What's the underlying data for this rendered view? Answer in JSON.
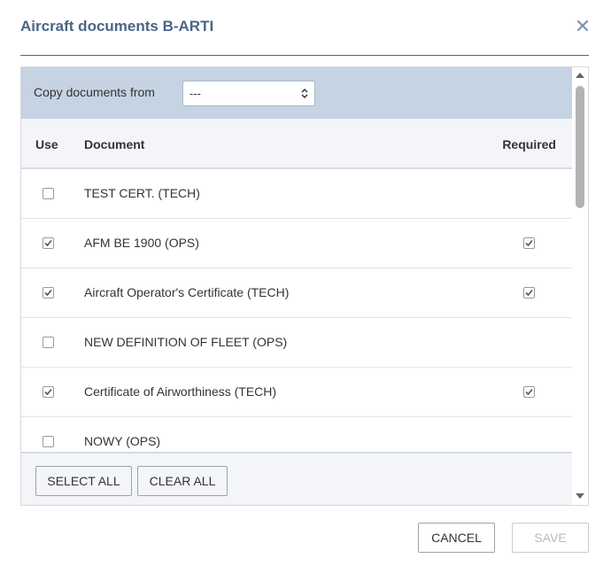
{
  "dialog": {
    "title": "Aircraft documents B-ARTI",
    "close_icon": "close-icon"
  },
  "copy_from": {
    "label": "Copy documents from",
    "selected": "---"
  },
  "table": {
    "headers": {
      "use": "Use",
      "document": "Document",
      "required": "Required"
    },
    "rows": [
      {
        "name": "TEST CERT. (TECH)",
        "use": false,
        "required": false
      },
      {
        "name": "AFM BE 1900 (OPS)",
        "use": true,
        "required": true
      },
      {
        "name": "Aircraft Operator's Certificate (TECH)",
        "use": true,
        "required": true
      },
      {
        "name": "NEW DEFINITION OF FLEET (OPS)",
        "use": false,
        "required": false
      },
      {
        "name": "Certificate of Airworthiness (TECH)",
        "use": true,
        "required": true
      },
      {
        "name": "NOWY (OPS)",
        "use": false,
        "required": false
      }
    ]
  },
  "footer": {
    "select_all": "SELECT ALL",
    "clear_all": "CLEAR ALL"
  },
  "actions": {
    "cancel": "CANCEL",
    "save": "SAVE"
  },
  "colors": {
    "title": "#4a6587",
    "copy_bar": "#c5d3e3",
    "header_bg": "#f3f5f8"
  }
}
